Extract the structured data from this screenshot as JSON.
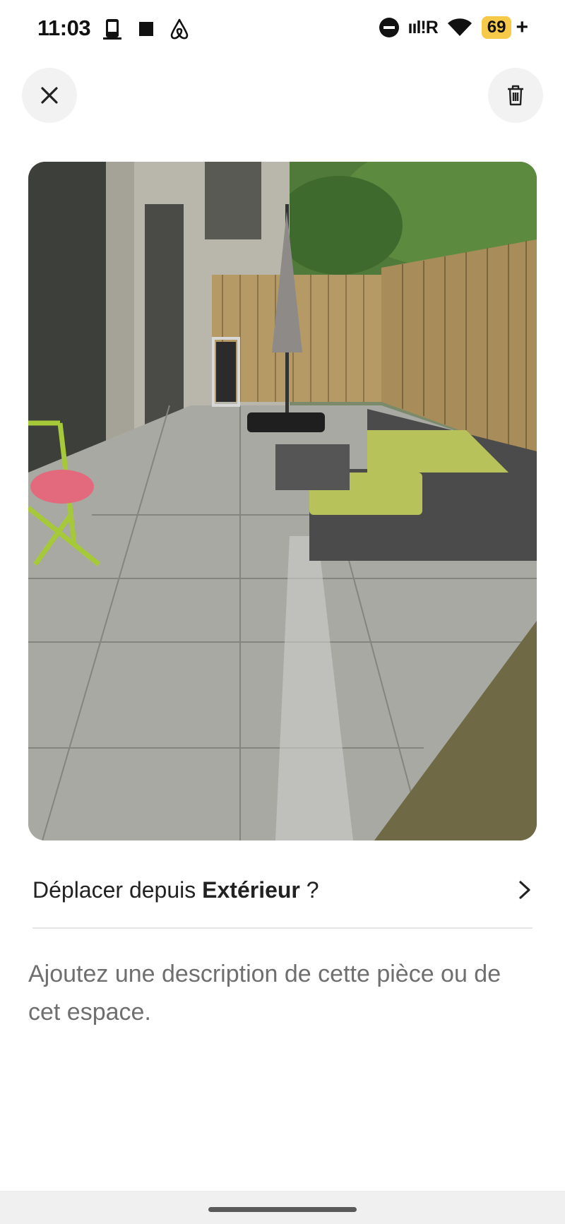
{
  "status_bar": {
    "time": "11:03",
    "network": "ııl!R",
    "battery": "69",
    "battery_suffix": "+"
  },
  "header": {
    "close_icon": "close-icon",
    "delete_icon": "trash-icon"
  },
  "photo": {
    "subject": "patio-photo"
  },
  "move_row": {
    "prefix": "Déplacer depuis ",
    "room": "Extérieur",
    "suffix": " ?",
    "icon": "chevron-right-icon"
  },
  "description": {
    "placeholder": "Ajoutez une description de cette pièce ou de cet espace."
  },
  "colors": {
    "battery": "#f7c948",
    "button_bg": "#f2f2f2",
    "placeholder_text": "#6f6f6f"
  }
}
